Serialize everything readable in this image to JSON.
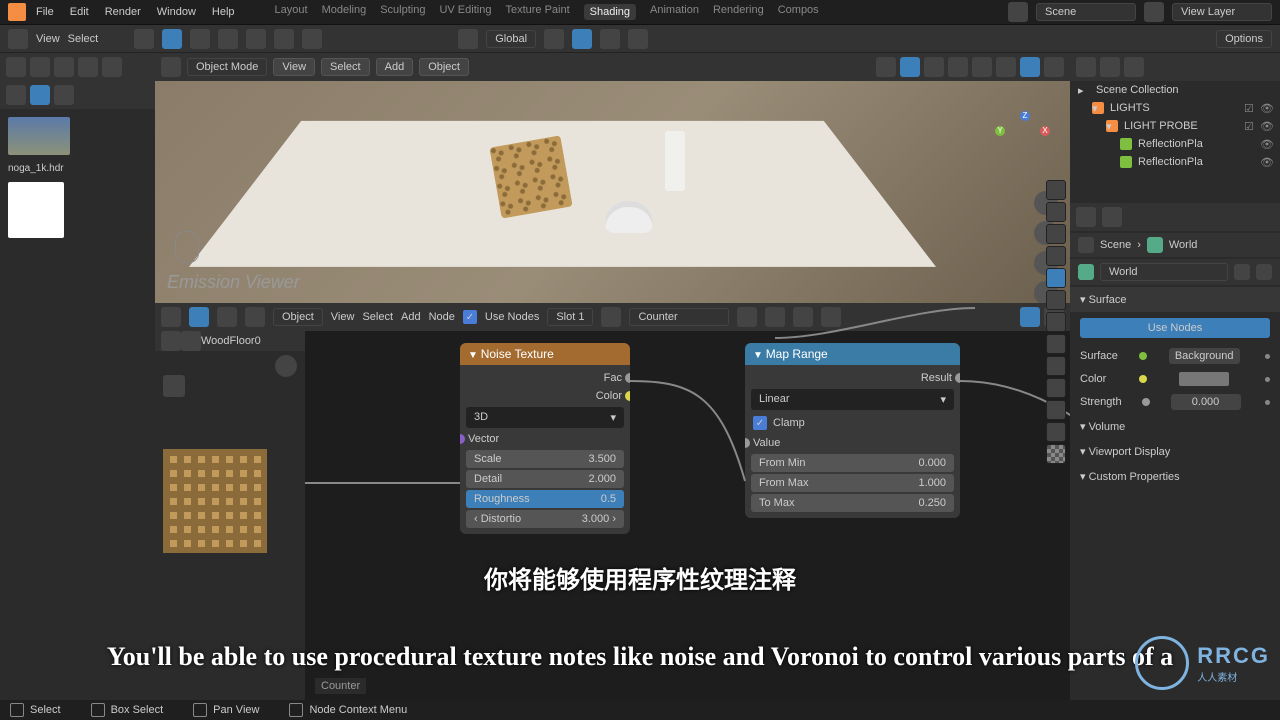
{
  "topmenu": [
    "File",
    "Edit",
    "Render",
    "Window",
    "Help"
  ],
  "workspaces": [
    "Layout",
    "Modeling",
    "Sculpting",
    "UV Editing",
    "Texture Paint",
    "Shading",
    "Animation",
    "Rendering",
    "Compos"
  ],
  "workspace_active": "Shading",
  "scene_field": "Scene",
  "viewlayer_field": "View Layer",
  "toolbar2": {
    "view": "View",
    "select": "Select",
    "global": "Global",
    "options": "Options"
  },
  "left_header_mode": "Image",
  "hdr_name": "noga_1k.hdr",
  "viewport": {
    "mode": "Object Mode",
    "btns": [
      "View",
      "Select",
      "Add",
      "Object"
    ],
    "emission_label": "Emission Viewer",
    "axis": {
      "x": "X",
      "y": "Y",
      "z": "Z"
    }
  },
  "node_header": {
    "mode": "Object",
    "btns": [
      "View",
      "Select",
      "Add",
      "Node"
    ],
    "use_nodes": "Use Nodes",
    "slot": "Slot 1",
    "material": "Counter"
  },
  "node_left_material": "WoodFloor0",
  "noise_node": {
    "title": "Noise Texture",
    "fac": "Fac",
    "color": "Color",
    "dim": "3D",
    "vector": "Vector",
    "scale_l": "Scale",
    "scale_v": "3.500",
    "detail_l": "Detail",
    "detail_v": "2.000",
    "rough_l": "Roughness",
    "rough_v": "0.5",
    "distort_l": "Distortio",
    "distort_v": "3.000"
  },
  "map_node": {
    "title": "Map Range",
    "result": "Result",
    "interp": "Linear",
    "clamp": "Clamp",
    "value": "Value",
    "fmin_l": "From Min",
    "fmin_v": "0.000",
    "fmax_l": "From Max",
    "fmax_v": "1.000",
    "tmax_l": "To Max",
    "tmax_v": "0.250"
  },
  "footer_label": "Counter",
  "outliner": {
    "scene_collection": "Scene Collection",
    "lights": "LIGHTS",
    "light_probe": "LIGHT PROBE",
    "refl1": "ReflectionPla",
    "refl2": "ReflectionPla"
  },
  "props": {
    "scene": "Scene",
    "world": "World",
    "world_field": "World",
    "surface_panel": "Surface",
    "use_nodes": "Use Nodes",
    "surface_l": "Surface",
    "surface_v": "Background",
    "color_l": "Color",
    "strength_l": "Strength",
    "strength_v": "0.000",
    "volume": "Volume",
    "viewport_display": "Viewport Display",
    "custom_props": "Custom Properties"
  },
  "subtitle_cn": "你将能够使用程序性纹理注释",
  "subtitle_en": "You'll be able to use procedural texture notes like noise and Voronoi to control various parts of a",
  "statusbar": {
    "select": "Select",
    "box": "Box Select",
    "pan": "Pan View",
    "ctx": "Node Context Menu"
  },
  "watermark": {
    "text": "RRCG",
    "sub": "人人素材"
  }
}
